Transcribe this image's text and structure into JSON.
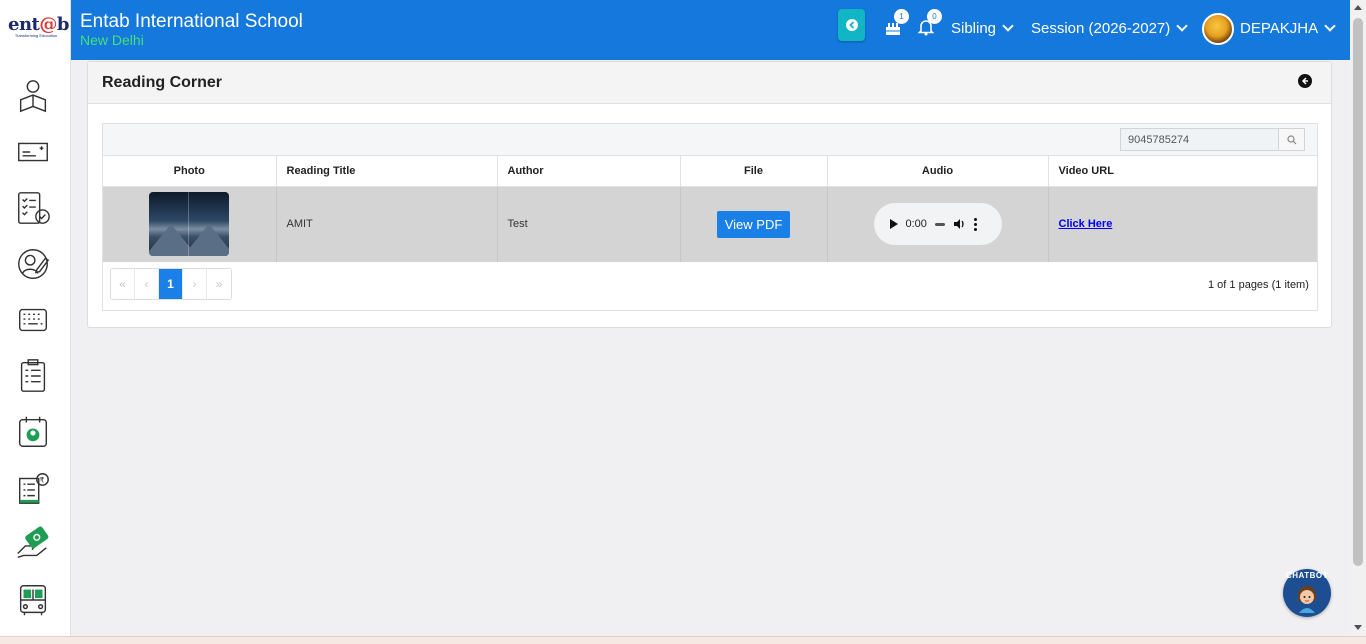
{
  "header": {
    "school_name": "Entab International School",
    "school_city": "New Delhi",
    "birthday_count": "1",
    "notification_count": "0",
    "sibling_label": "Sibling",
    "session_label": "Session (2026-2027)",
    "user_name": "DEPAKJHA"
  },
  "logo": {
    "text_a": "ent",
    "text_at": "@",
    "text_b": "b",
    "tagline": "Transforming Education"
  },
  "sidebar": {
    "items": [
      {
        "icon": "student-book-icon"
      },
      {
        "icon": "id-card-icon"
      },
      {
        "icon": "checklist-icon"
      },
      {
        "icon": "user-edit-icon"
      },
      {
        "icon": "keyboard-icon"
      },
      {
        "icon": "clipboard-list-icon"
      },
      {
        "icon": "calendar-user-icon"
      },
      {
        "icon": "fee-receipt-icon"
      },
      {
        "icon": "payment-hand-icon"
      },
      {
        "icon": "bus-icon"
      }
    ]
  },
  "page": {
    "title": "Reading Corner",
    "search_value": "9045785274"
  },
  "table": {
    "columns": [
      "Photo",
      "Reading Title",
      "Author",
      "File",
      "Audio",
      "Video URL"
    ],
    "rows": [
      {
        "reading_title": "AMIT",
        "author": "Test",
        "file_button": "View PDF",
        "audio_time": "0:00",
        "video_link": "Click Here"
      }
    ]
  },
  "pager": {
    "current_page": "1",
    "info": "1 of 1 pages (1 item)"
  },
  "chatbot": {
    "label": "CHATBOT"
  },
  "colors": {
    "header_bg": "#1478dc",
    "accent_teal": "#12b5c4",
    "city_green": "#46e07a",
    "primary_button": "#1a7fe6"
  }
}
